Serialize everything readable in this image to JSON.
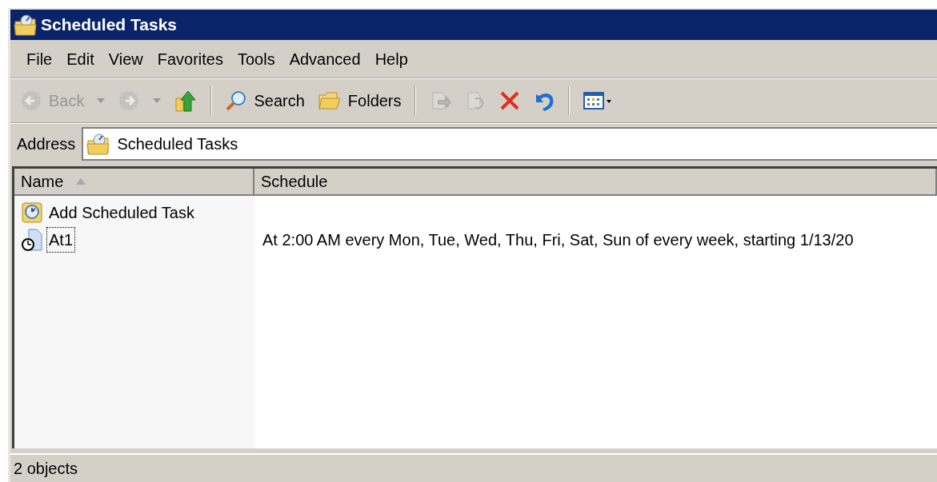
{
  "window": {
    "title": "Scheduled Tasks"
  },
  "menu": [
    {
      "label": "File"
    },
    {
      "label": "Edit"
    },
    {
      "label": "View"
    },
    {
      "label": "Favorites"
    },
    {
      "label": "Tools"
    },
    {
      "label": "Advanced"
    },
    {
      "label": "Help"
    }
  ],
  "toolbar": [
    {
      "kind": "back",
      "label": "Back",
      "disabled": true
    },
    {
      "kind": "forward",
      "disabled": true
    },
    {
      "kind": "up",
      "disabled": false
    },
    {
      "kind": "separator"
    },
    {
      "kind": "search",
      "label": "Search",
      "disabled": false
    },
    {
      "kind": "folders",
      "label": "Folders",
      "disabled": false
    },
    {
      "kind": "separator"
    },
    {
      "kind": "move",
      "disabled": true
    },
    {
      "kind": "copy",
      "disabled": true
    },
    {
      "kind": "delete",
      "disabled": false
    },
    {
      "kind": "undo",
      "disabled": false
    },
    {
      "kind": "separator"
    },
    {
      "kind": "views",
      "disabled": false
    }
  ],
  "address": {
    "label": "Address",
    "value": "Scheduled Tasks"
  },
  "table": {
    "columns": [
      {
        "label": "Name",
        "sorted": true
      },
      {
        "label": "Schedule",
        "sorted": false
      }
    ],
    "rows": [
      {
        "kind": "wizard",
        "name": "Add Scheduled Task",
        "focused": false
      },
      {
        "kind": "task",
        "name": "At1",
        "schedule": "At 2:00 AM every Mon, Tue, Wed, Thu, Fri, Sat, Sun of every week, starting 1/13/20",
        "focused": true
      }
    ]
  },
  "status_bar": {
    "text": "2 objects"
  }
}
